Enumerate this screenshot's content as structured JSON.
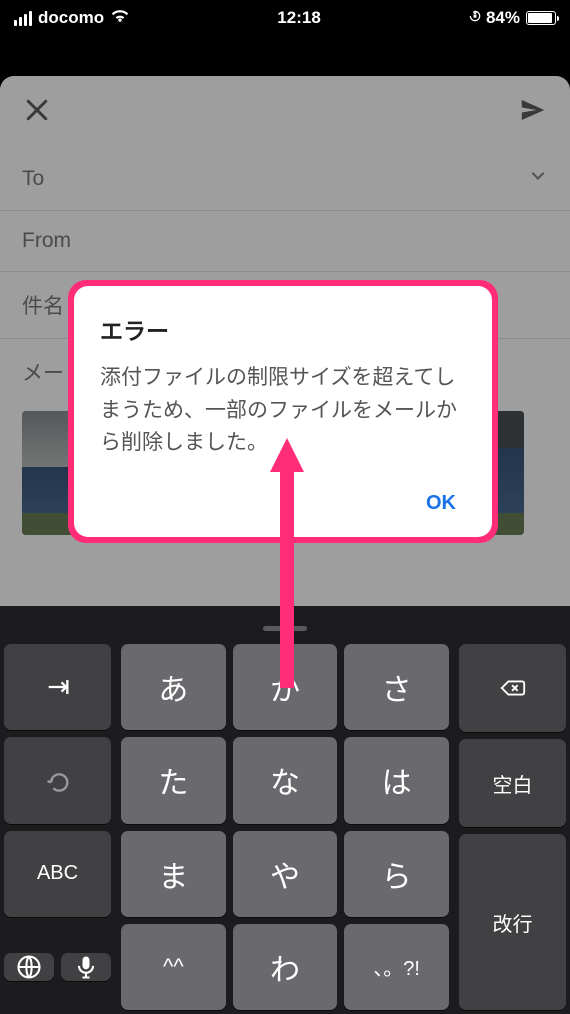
{
  "status": {
    "carrier": "docomo",
    "time": "12:18",
    "battery_pct": "84%"
  },
  "compose": {
    "to_label": "To",
    "from_label": "From",
    "subject_label": "件名",
    "body_placeholder": "メー"
  },
  "modal": {
    "title": "エラー",
    "message": "添付ファイルの制限サイズを超えてしまうため、一部のファイルをメールから削除しました。",
    "ok": "OK"
  },
  "keyboard": {
    "rows": {
      "a": "あ",
      "ka": "か",
      "sa": "さ",
      "ta": "た",
      "na": "な",
      "ha": "は",
      "ma": "ま",
      "ya": "や",
      "ra": "ら",
      "face": "^^",
      "wa": "わ",
      "punct": "、。?!"
    },
    "fn": {
      "next": "→",
      "abc": "ABC",
      "space": "空白",
      "enter": "改行"
    }
  }
}
